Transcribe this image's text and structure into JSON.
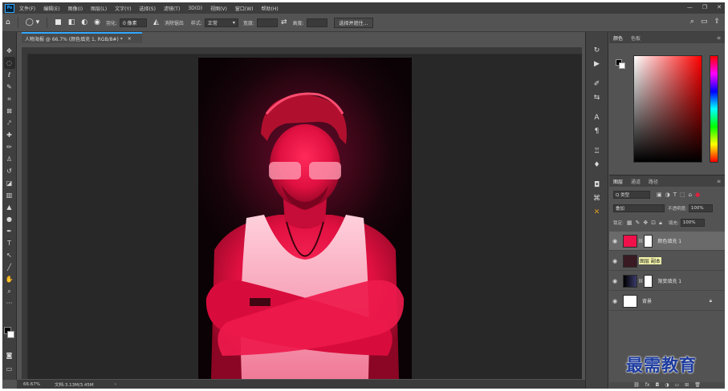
{
  "menu": {
    "logo": "Ps",
    "items": [
      "文件(F)",
      "编辑(E)",
      "图像(I)",
      "图层(L)",
      "文字(Y)",
      "选择(S)",
      "滤镜(T)",
      "3D(D)",
      "视图(V)",
      "窗口(W)",
      "帮助(H)"
    ],
    "window_controls": [
      "—",
      "❐",
      "✕"
    ]
  },
  "options": {
    "feather_label": "羽化:",
    "feather_value": "0 像素",
    "antialias_label": "消除锯齿",
    "style_label": "样式:",
    "style_value": "正常",
    "width_label": "宽度:",
    "height_label": "高度:",
    "select_subject": "选择并遮住..."
  },
  "document": {
    "tab_title": "人物海报 @ 66.7% (颜色填充 1, RGB/8#) *",
    "close_glyph": "×",
    "status_zoom": "66.67%",
    "status_doc": "文档:3.13M/3.45M",
    "status_arrow": "›"
  },
  "color_panel": {
    "tabs": [
      "颜色",
      "色板"
    ],
    "fg_color": "#000000",
    "bg_color": "#ffffff"
  },
  "layers_panel": {
    "tabs": [
      "图层",
      "通道",
      "路径"
    ],
    "filter_kind": "Q 类型",
    "blend_mode": "叠加",
    "opacity_label": "不透明度:",
    "opacity_value": "100%",
    "lock_label": "锁定:",
    "fill_label": "填充:",
    "fill_value": "100%",
    "layers": [
      {
        "name": "颜色填充 1",
        "thumb_color": "#f0104a",
        "has_mask": true,
        "selected": true
      },
      {
        "name": "图层 副本",
        "thumb_color": "#3a1a22",
        "has_mask": false,
        "selected": false,
        "highlight": true
      },
      {
        "name": "渐变填充 1",
        "thumb_color": "#101020",
        "has_mask": true,
        "selected": false
      },
      {
        "name": "背景",
        "thumb_color": "#ffffff",
        "has_mask": false,
        "selected": false,
        "locked": true
      }
    ]
  },
  "watermark": "最需教育",
  "colors": {
    "ui_bg": "#535353",
    "canvas_bg": "#282828",
    "accent": "#31a8ff",
    "photo_red": "#f0104a"
  }
}
